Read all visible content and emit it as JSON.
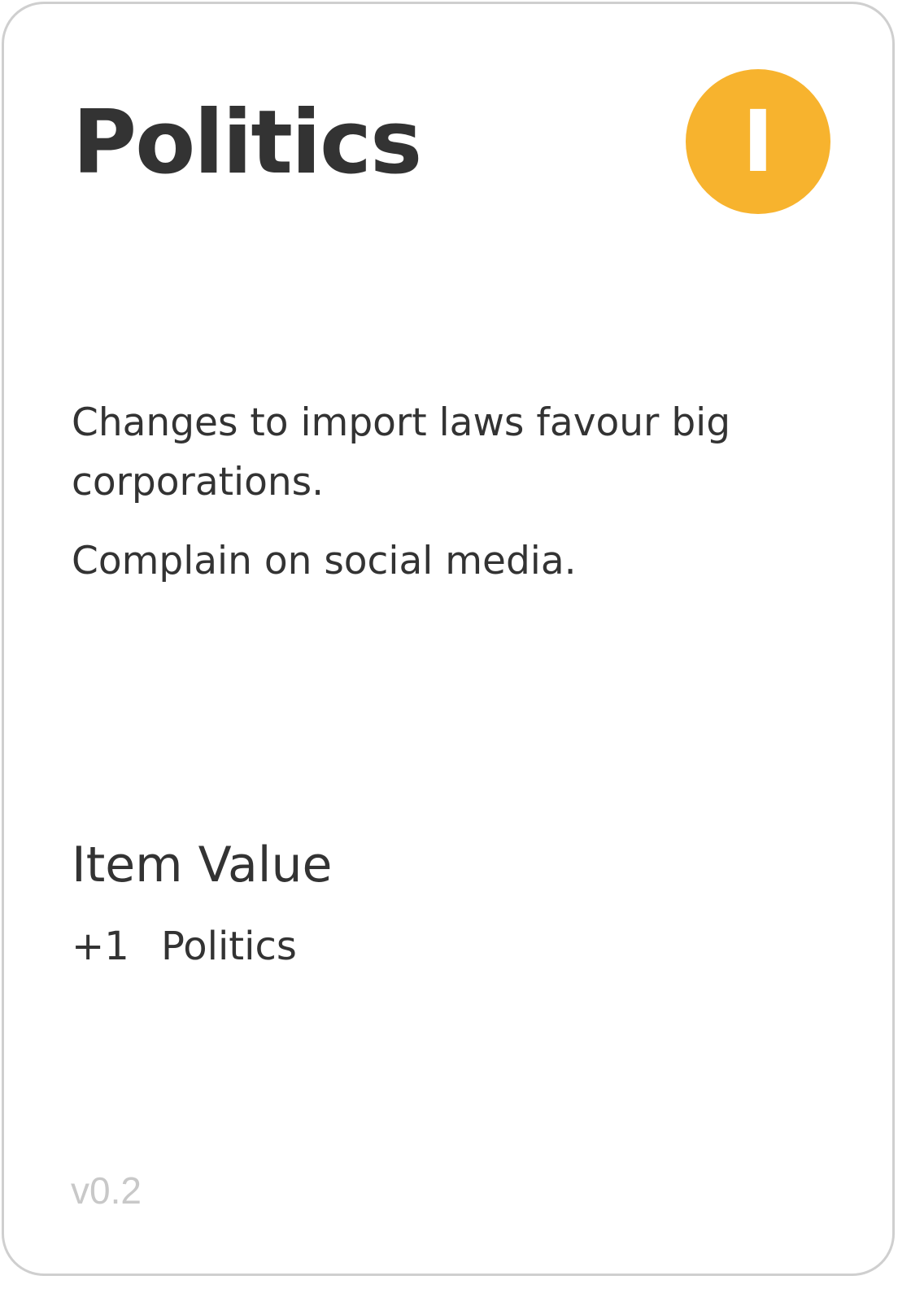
{
  "card": {
    "title": "Politics",
    "badge": {
      "letter": "I",
      "color": "#f7b32e"
    },
    "description": [
      "Changes to import laws favour big corporations.",
      "Complain on social media."
    ],
    "item_value": {
      "heading": "Item Value",
      "amount": "+1",
      "category": "Politics"
    },
    "version": "v0.2"
  }
}
